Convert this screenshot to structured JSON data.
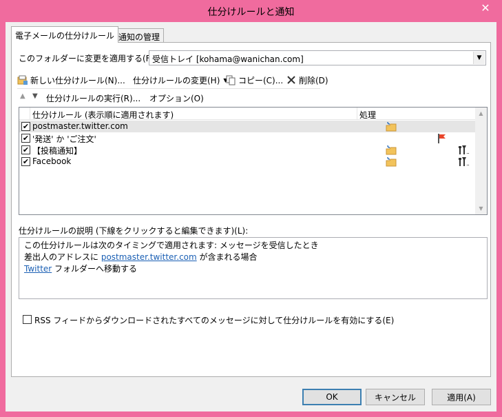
{
  "window": {
    "title": "仕分けルールと通知",
    "close": "✕"
  },
  "tabs": [
    {
      "label": "電子メールの仕分けルール"
    },
    {
      "label": "通知の管理"
    }
  ],
  "folder": {
    "label": "このフォルダーに変更を適用する(F):",
    "value": "受信トレイ [kohama@wanichan.com]"
  },
  "toolbar": {
    "new_rule": "新しい仕分けルール(N)...",
    "change_rule": "仕分けルールの変更(H)",
    "copy": "コピー(C)...",
    "delete": "削除(D)"
  },
  "run_row": {
    "run": "仕分けルールの実行(R)...",
    "options": "オプション(O)"
  },
  "list": {
    "col_rule": "仕分けルール (表示順に適用されます)",
    "col_action": "処理",
    "rows": [
      {
        "name": "postmaster.twitter.com",
        "checked": "✔"
      },
      {
        "name": "'発送' か 'ご注文'",
        "checked": "✔"
      },
      {
        "name": "【投稿通知】",
        "checked": "✔"
      },
      {
        "name": "Facebook",
        "checked": "✔"
      }
    ]
  },
  "description": {
    "label": "仕分けルールの説明 (下線をクリックすると編集できます)(L):",
    "line1": "この仕分けルールは次のタイミングで適用されます: メッセージを受信したとき",
    "line2_pre": "差出人のアドレスに ",
    "line2_link": "postmaster.twitter.com",
    "line2_post": " が含まれる場合",
    "line3_link": "Twitter",
    "line3_post": " フォルダーへ移動する"
  },
  "rss": {
    "label": "RSS フィードからダウンロードされたすべてのメッセージに対して仕分けルールを有効にする(E)"
  },
  "buttons": {
    "ok": "OK",
    "cancel": "キャンセル",
    "apply": "適用(A)"
  },
  "colors": {
    "frame": "#f06b9e",
    "panel": "#f0f0f0",
    "link": "#1a5fb4",
    "selected_row": "#e5e5e5",
    "flag": "#e8452a",
    "folder": "#f2c35b"
  }
}
